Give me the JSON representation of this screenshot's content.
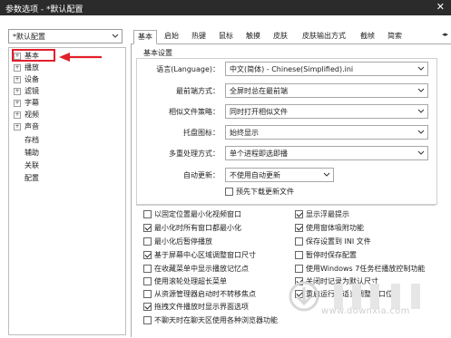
{
  "window": {
    "title": "参数选项 - *默认配置",
    "close_glyph": "✕"
  },
  "profile_select": {
    "value": "*默认配置"
  },
  "tree": {
    "items": [
      {
        "label": "基本",
        "expandable": true
      },
      {
        "label": "播放",
        "expandable": true
      },
      {
        "label": "设备",
        "expandable": true
      },
      {
        "label": "滤镜",
        "expandable": true
      },
      {
        "label": "字幕",
        "expandable": true
      },
      {
        "label": "视频",
        "expandable": true
      },
      {
        "label": "声音",
        "expandable": true
      },
      {
        "label": "存档",
        "expandable": false
      },
      {
        "label": "辅助",
        "expandable": false
      },
      {
        "label": "关联",
        "expandable": false
      },
      {
        "label": "配置",
        "expandable": false
      }
    ]
  },
  "tabs": [
    "基本",
    "启始",
    "热键",
    "鼠标",
    "触摸",
    "皮肤",
    "皮肤输出方式",
    "截帧",
    "简索"
  ],
  "scroll_glyphs": "◂▸",
  "basic": {
    "section_title": "基本设置",
    "rows": [
      {
        "label": "语言(Language)：",
        "value": "中文(简体) - Chinese(Simplified).ini"
      },
      {
        "label": "最前端方式：",
        "value": "全屏时总在最前端"
      },
      {
        "label": "相似文件策略：",
        "value": "同时打开相似文件"
      },
      {
        "label": "托盘图标：",
        "value": "始终显示"
      },
      {
        "label": "多重处理方式：",
        "value": "单个进程即选即播"
      },
      {
        "label": "自动更新：",
        "value": "不使用自动更新"
      }
    ],
    "preview_update": {
      "label": "预先下载更新文件",
      "checked": false
    }
  },
  "options_left": [
    {
      "label": "以固定位置最小化视频窗口",
      "checked": false
    },
    {
      "label": "最小化时所有窗口都最小化",
      "checked": true
    },
    {
      "label": "最小化后暂停播放",
      "checked": false
    },
    {
      "label": "基于屏幕中心区域调整窗口尺寸",
      "checked": true
    },
    {
      "label": "在收藏菜单中显示播放记忆点",
      "checked": false
    },
    {
      "label": "使用滚轮处理超长菜单",
      "checked": false
    },
    {
      "label": "从资源管理器启动时不转移焦点",
      "checked": false
    },
    {
      "label": "拖拽文件播放时显示界面选项",
      "checked": true
    },
    {
      "label": "不聊天时在聊天区使用各种浏览器功能",
      "checked": false
    }
  ],
  "options_right": [
    {
      "label": "显示浮最提示",
      "checked": true
    },
    {
      "label": "使用窗体吸附功能",
      "checked": true
    },
    {
      "label": "保存设置到 INI 文件",
      "checked": false
    },
    {
      "label": "暂停时保存配置",
      "checked": false
    },
    {
      "label": "使用Windows 7任务栏播放控制功能",
      "checked": false
    },
    {
      "label": "关闭时记录为默认尺寸",
      "checked": true
    },
    {
      "label": "重启运行时适当调整窗口位置",
      "checked": true
    }
  ],
  "watermark": {
    "text": "www.downxia.com"
  },
  "colors": {
    "annotation_red": "#e2202a",
    "titlebar": "#2b2b2b"
  }
}
